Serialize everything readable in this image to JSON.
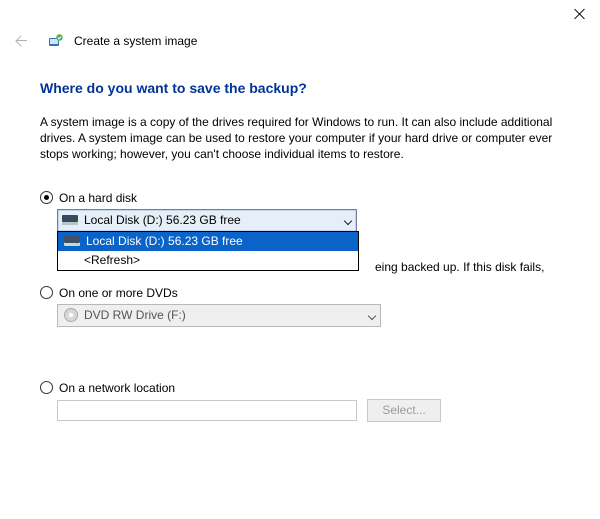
{
  "window": {
    "title": "Create a system image"
  },
  "main": {
    "heading": "Where do you want to save the backup?",
    "description": "A system image is a copy of the drives required for Windows to run. It can also include additional drives. A system image can be used to restore your computer if your hard drive or computer ever stops working; however, you can't choose individual items to restore."
  },
  "options": {
    "hard_disk": {
      "label": "On a hard disk",
      "selected_text": "Local Disk (D:)  56.23 GB free",
      "dropdown": {
        "item_selected": "Local Disk (D:)  56.23 GB free",
        "refresh": "<Refresh>"
      },
      "warning_fragment": "eing backed up. If this disk fails,"
    },
    "dvd": {
      "label": "On one or more DVDs",
      "selected_text": "DVD RW Drive (F:)"
    },
    "network": {
      "label": "On a network location",
      "button": "Select...",
      "value": ""
    }
  }
}
